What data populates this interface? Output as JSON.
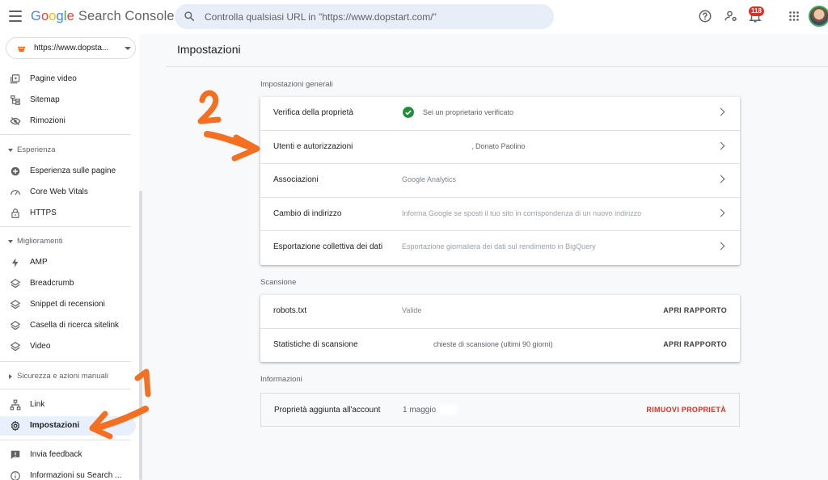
{
  "app": {
    "logo_google": [
      "G",
      "o",
      "o",
      "g",
      "l",
      "e"
    ],
    "logo_product": "Search Console"
  },
  "search": {
    "placeholder": "Controlla qualsiasi URL in \"https://www.dopstart.com/\""
  },
  "header": {
    "notifications_count": "118"
  },
  "property": {
    "label": "https://www.dopsta..."
  },
  "sidebar": {
    "items_top": [
      {
        "label": "Pagine video",
        "icon": "video-page-icon"
      },
      {
        "label": "Sitemap",
        "icon": "sitemap-icon"
      },
      {
        "label": "Rimozioni",
        "icon": "eye-off-icon"
      }
    ],
    "section_experience": "Esperienza",
    "items_experience": [
      {
        "label": "Esperienza sulle pagine",
        "icon": "plus-circle-icon"
      },
      {
        "label": "Core Web Vitals",
        "icon": "gauge-icon"
      },
      {
        "label": "HTTPS",
        "icon": "lock-icon"
      }
    ],
    "section_improvements": "Miglioramenti",
    "items_improvements": [
      {
        "label": "AMP",
        "icon": "bolt-icon"
      },
      {
        "label": "Breadcrumb",
        "icon": "layers-icon"
      },
      {
        "label": "Snippet di recensioni",
        "icon": "layers-icon"
      },
      {
        "label": "Casella di ricerca sitelink",
        "icon": "layers-icon"
      },
      {
        "label": "Video",
        "icon": "layers-icon"
      }
    ],
    "section_security": "Sicurezza e azioni manuali",
    "items_bottom": [
      {
        "label": "Link",
        "icon": "link-network-icon"
      },
      {
        "label": "Impostazioni",
        "icon": "gear-icon",
        "active": true
      }
    ],
    "items_footer": [
      {
        "label": "Invia feedback",
        "icon": "feedback-icon"
      },
      {
        "label": "Informazioni su Search ...",
        "icon": "info-icon"
      }
    ]
  },
  "main": {
    "title": "Impostazioni",
    "general": {
      "label": "Impostazioni generali",
      "rows": [
        {
          "label": "Verifica della proprietà",
          "value": "Sei un proprietario verificato"
        },
        {
          "label": "Utenti e autorizzazioni",
          "value": ", Donato Paolino"
        },
        {
          "label": "Associazioni",
          "value": "Google Analytics"
        },
        {
          "label": "Cambio di indirizzo",
          "value": "Informa Google se sposti il tuo sito in corrispondenza di un nuovo indirizzo"
        },
        {
          "label": "Esportazione collettiva dei dati",
          "value": "Esportazione giornaliera dei dati sul rendimento in BigQuery"
        }
      ]
    },
    "crawl": {
      "label": "Scansione",
      "rows": [
        {
          "label": "robots.txt",
          "value": "Valide",
          "action": "APRI RAPPORTO"
        },
        {
          "label": "Statistiche di scansione",
          "value": "chieste di scansione (ultimi 90 giorni)",
          "action": "APRI RAPPORTO"
        }
      ]
    },
    "info": {
      "label": "Informazioni",
      "row": {
        "label": "Proprietà aggiunta all'account",
        "value": "1 maggio",
        "action": "RIMUOVI PROPRIETÀ"
      }
    }
  },
  "annotations": {
    "one": "1",
    "two": "2"
  },
  "colors": {
    "accent": "#1a73e8",
    "active_bg": "#e8f0fe",
    "danger": "#d93025",
    "success": "#1e8e3e",
    "annotation": "#f36f21"
  }
}
